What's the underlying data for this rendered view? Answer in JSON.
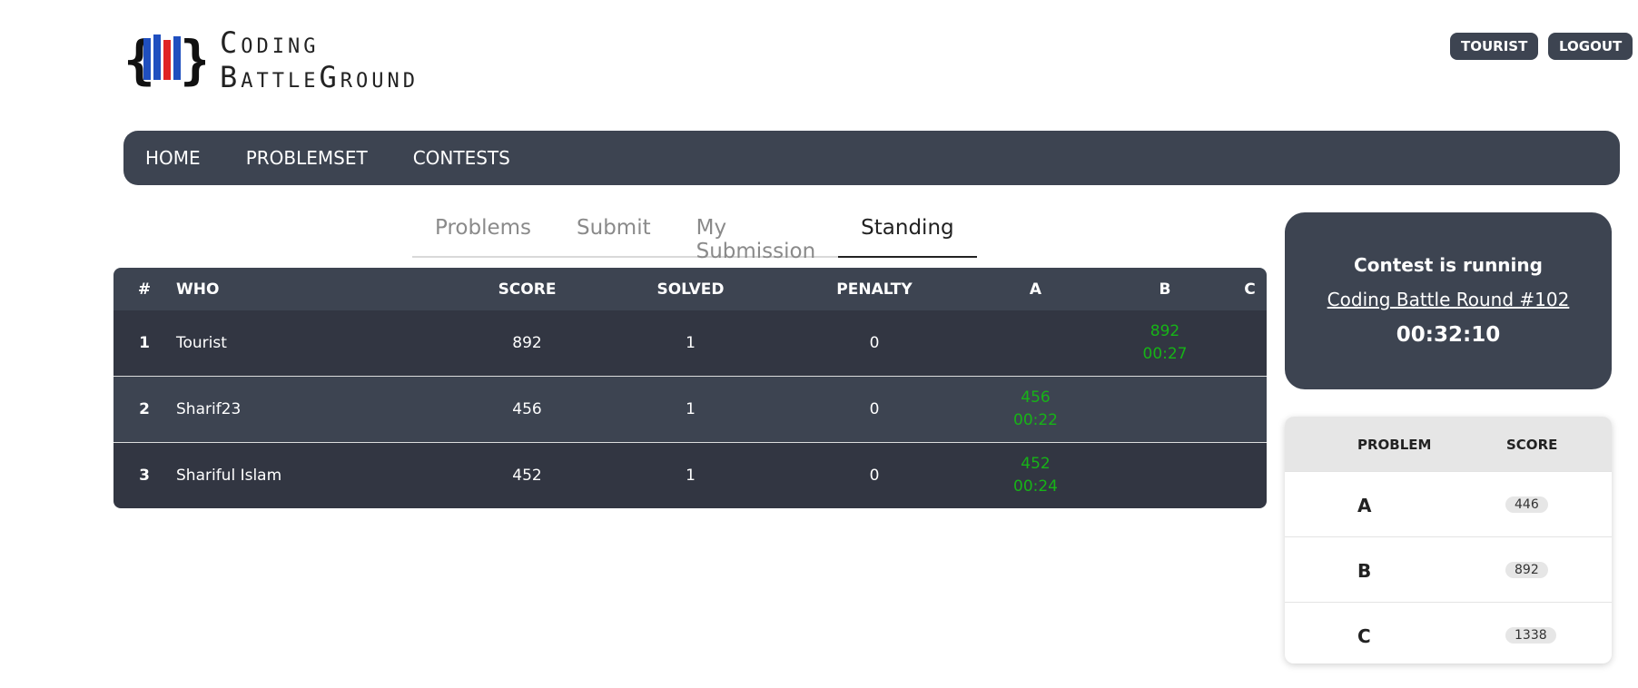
{
  "brand": {
    "line1": "Coding",
    "line2": "BattleGround"
  },
  "header": {
    "user_button": "TOURIST",
    "logout_button": "LOGOUT"
  },
  "nav": {
    "items": [
      "HOME",
      "PROBLEMSET",
      "CONTESTS"
    ]
  },
  "tabs": {
    "items": [
      "Problems",
      "Submit",
      "My Submission",
      "Standing"
    ],
    "active": "Standing"
  },
  "standings": {
    "columns": [
      "#",
      "WHO",
      "SCORE",
      "SOLVED",
      "PENALTY",
      "A",
      "B",
      "C"
    ],
    "rows": [
      {
        "rank": "1",
        "who": "Tourist",
        "score": "892",
        "solved": "1",
        "penalty": "0",
        "a": {
          "score": "",
          "time": ""
        },
        "b": {
          "score": "892",
          "time": "00:27"
        },
        "c": {
          "score": "",
          "time": ""
        }
      },
      {
        "rank": "2",
        "who": "Sharif23",
        "score": "456",
        "solved": "1",
        "penalty": "0",
        "a": {
          "score": "456",
          "time": "00:22"
        },
        "b": {
          "score": "",
          "time": ""
        },
        "c": {
          "score": "",
          "time": ""
        }
      },
      {
        "rank": "3",
        "who": "Shariful Islam",
        "score": "452",
        "solved": "1",
        "penalty": "0",
        "a": {
          "score": "452",
          "time": "00:24"
        },
        "b": {
          "score": "",
          "time": ""
        },
        "c": {
          "score": "",
          "time": ""
        }
      }
    ]
  },
  "contest": {
    "status": "Contest is running",
    "name": "Coding Battle Round #102",
    "timer": "00:32:10"
  },
  "problem_table": {
    "headers": {
      "problem": "PROBLEM",
      "score": "SCORE"
    },
    "rows": [
      {
        "problem": "A",
        "score": "446"
      },
      {
        "problem": "B",
        "score": "892"
      },
      {
        "problem": "C",
        "score": "1338"
      }
    ]
  },
  "colors": {
    "accent_dark": "#3d4451",
    "row_dark": "#323642",
    "solved_green": "#17b317"
  }
}
